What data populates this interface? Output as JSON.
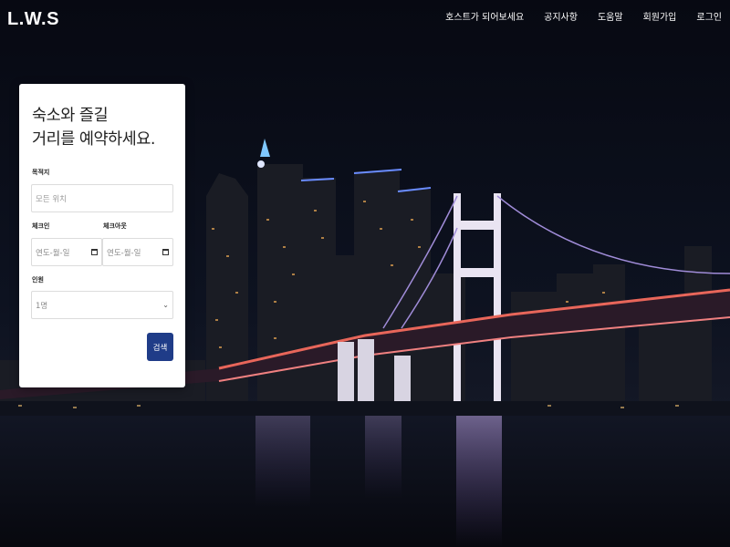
{
  "header": {
    "brand": "L.W.S",
    "nav": [
      {
        "label": "호스트가 되어보세요"
      },
      {
        "label": "공지사항"
      },
      {
        "label": "도움말"
      },
      {
        "label": "회원가입"
      },
      {
        "label": "로그인"
      }
    ]
  },
  "search_card": {
    "title_line1": "숙소와 즐길",
    "title_line2": "거리를 예약하세요.",
    "destination_label": "목적지",
    "destination_placeholder": "모든 위치",
    "checkin_label": "체크인",
    "checkin_value": "연도-월-일",
    "checkout_label": "체크아웃",
    "checkout_value": "연도-월-일",
    "guests_label": "인원",
    "guests_value": "1명",
    "search_button": "검색"
  },
  "colors": {
    "accent": "#1f3c88",
    "card_bg": "#ffffff",
    "sky": "#0a0c14",
    "bridge_lights": "#e8665a"
  },
  "icons": {
    "date_picker": "calendar-icon",
    "select": "chevron-down-icon"
  }
}
